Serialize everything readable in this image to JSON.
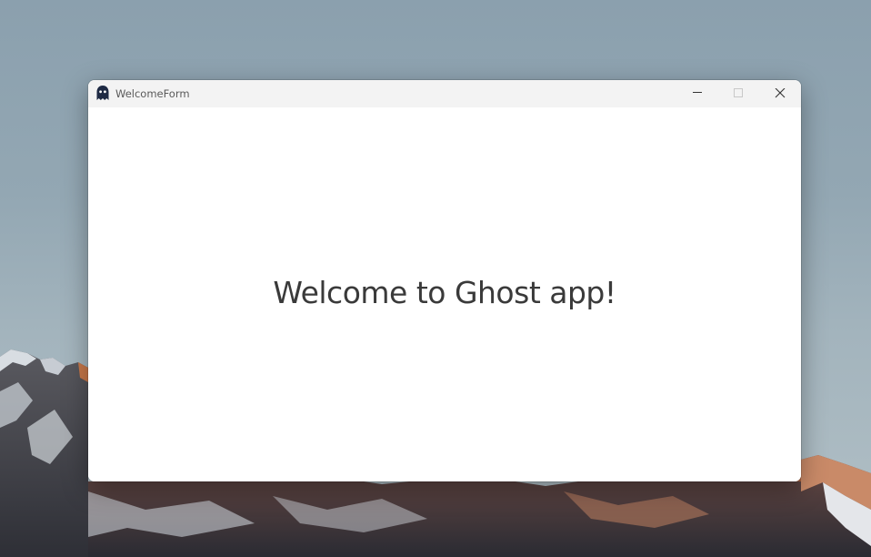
{
  "window": {
    "title": "WelcomeForm",
    "app_icon": "ghost-icon",
    "controls": {
      "minimize_icon": "minimize-icon",
      "maximize_icon": "maximize-icon",
      "maximize_enabled": false,
      "close_icon": "close-icon"
    }
  },
  "content": {
    "welcome_text": "Welcome to Ghost app!"
  },
  "colors": {
    "titlebar": "#f3f3f3",
    "content_background": "#ffffff",
    "welcome_text": "#3a3a3a",
    "icon": "#1e2a44"
  }
}
